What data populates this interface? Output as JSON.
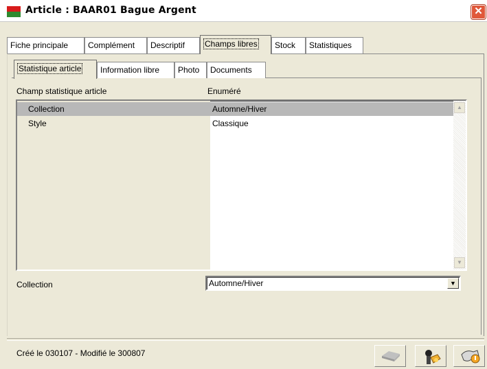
{
  "window": {
    "title": "Article : BAAR01 Bague Argent",
    "close_glyph": "✕"
  },
  "tabs_outer": [
    {
      "label": "Fiche principale",
      "active": false
    },
    {
      "label": "Complément",
      "active": false
    },
    {
      "label": "Descriptif",
      "active": false
    },
    {
      "label": "Champs libres",
      "active": true
    },
    {
      "label": "Stock",
      "active": false
    },
    {
      "label": "Statistiques",
      "active": false
    }
  ],
  "tabs_inner": [
    {
      "label": "Statistique article",
      "active": true
    },
    {
      "label": "Information libre",
      "active": false
    },
    {
      "label": "Photo",
      "active": false
    },
    {
      "label": "Documents",
      "active": false
    }
  ],
  "list": {
    "headers": [
      "Champ statistique article",
      "Enuméré"
    ],
    "rows": [
      {
        "field": "Collection",
        "value": "Automne/Hiver",
        "selected": true
      },
      {
        "field": "Style",
        "value": "Classique",
        "selected": false
      }
    ],
    "scroll_up": "▲",
    "scroll_down": "▼"
  },
  "editor": {
    "label": "Collection",
    "value": "Automne/Hiver",
    "arrow": "▼"
  },
  "status": {
    "text": "Créé le 030107 - Modifié le 300807"
  },
  "toolbar": [
    {
      "icon": "eraser-icon",
      "enabled": false
    },
    {
      "icon": "tools-icon",
      "enabled": true
    },
    {
      "icon": "help-icon",
      "enabled": true
    }
  ]
}
